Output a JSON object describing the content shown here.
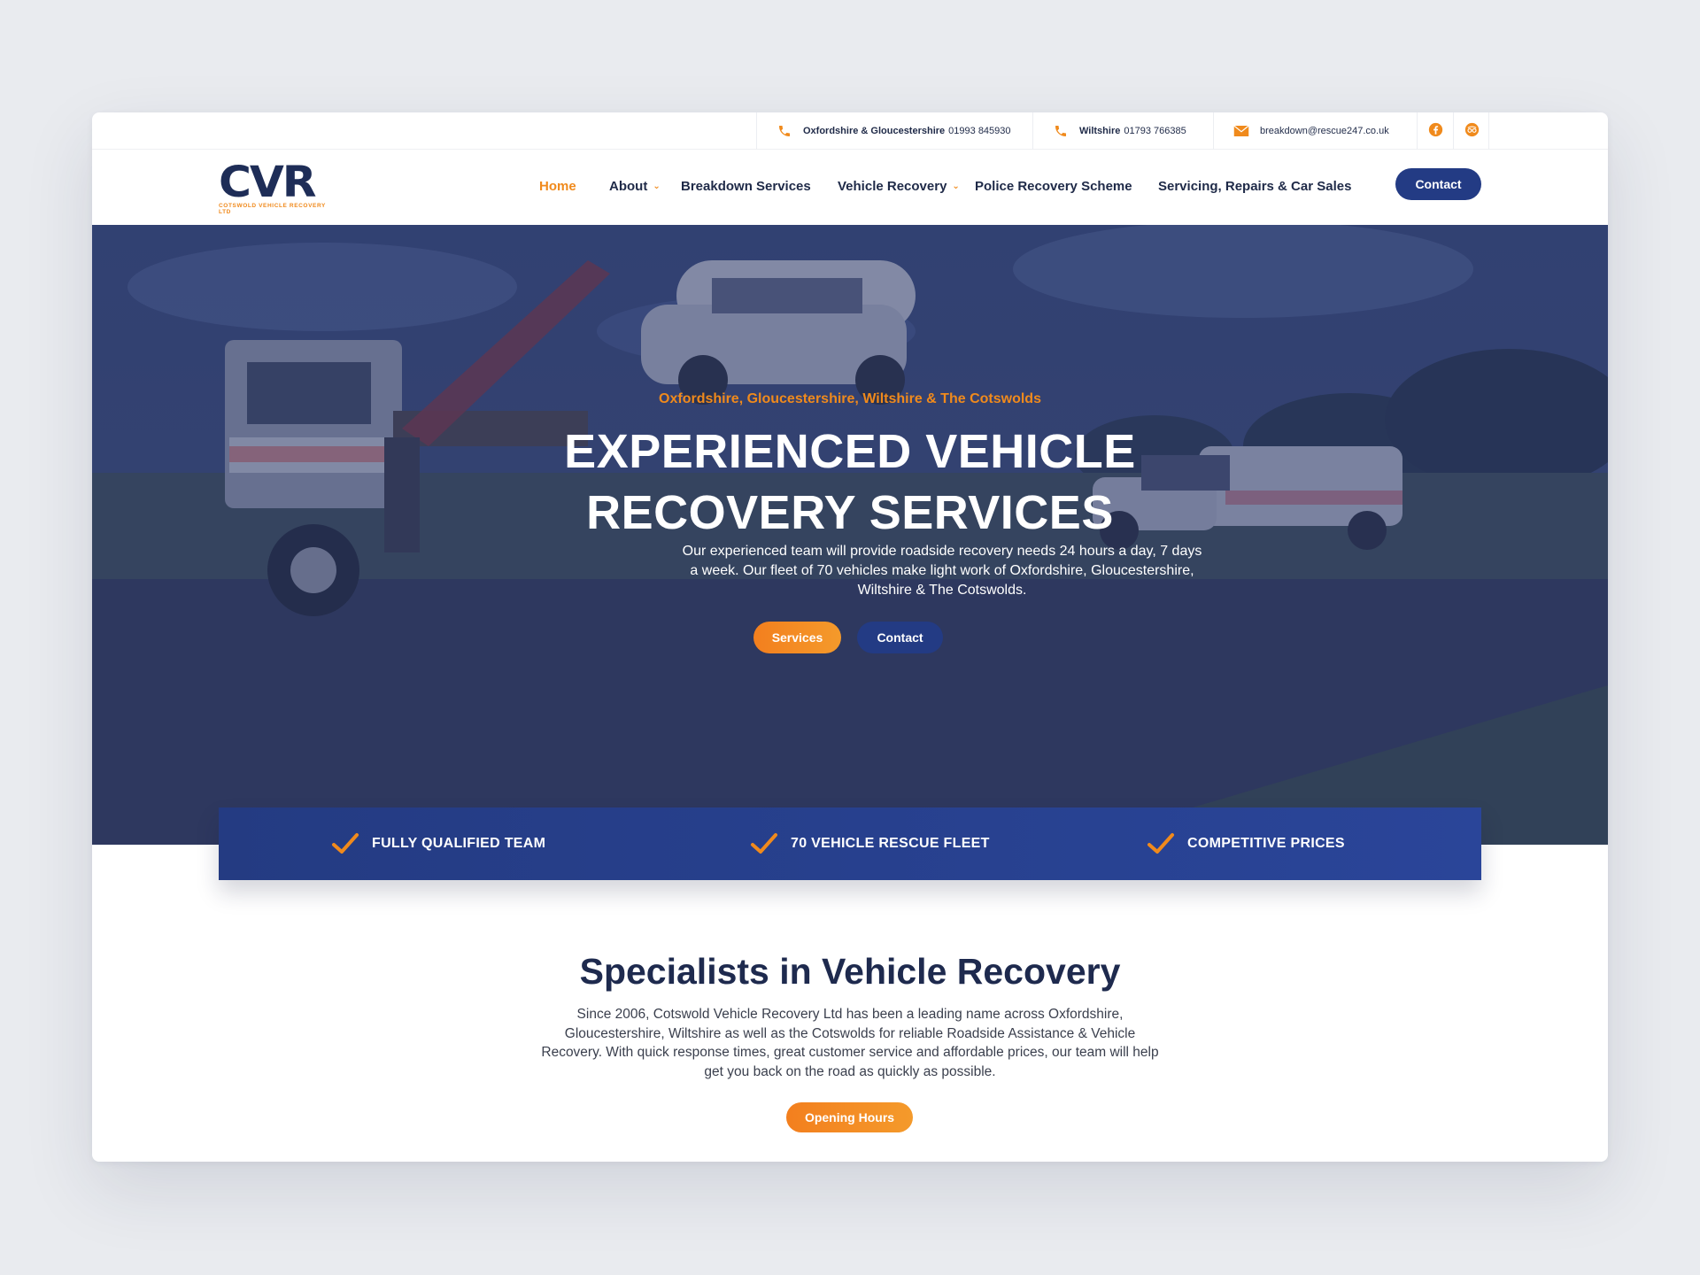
{
  "topbar": {
    "contacts": [
      {
        "region": "Oxfordshire & Gloucestershire",
        "number": "01993 845930",
        "icon": "phone-icon"
      },
      {
        "region": "Wiltshire",
        "number": "01793 766385",
        "icon": "phone-icon"
      },
      {
        "email": "breakdown@rescue247.co.uk",
        "icon": "mail-icon"
      }
    ],
    "social": [
      "facebook-icon",
      "tripadvisor-icon"
    ]
  },
  "logo": {
    "text": "CVR",
    "subtitle": "COTSWOLD VEHICLE RECOVERY LTD"
  },
  "nav": {
    "items": [
      {
        "label": "Home",
        "active": true
      },
      {
        "label": "About",
        "dropdown": true
      },
      {
        "label": "Breakdown Services"
      },
      {
        "label": "Vehicle Recovery",
        "dropdown": true
      },
      {
        "label": "Police Recovery Scheme"
      },
      {
        "label": "Servicing, Repairs & Car Sales"
      }
    ],
    "contact_label": "Contact"
  },
  "hero": {
    "kicker": "Oxfordshire,  Gloucestershire, Wiltshire & The Cotswolds",
    "title_line1": "EXPERIENCED VEHICLE",
    "title_line2": "RECOVERY SERVICES",
    "text": "Our experienced team will provide roadside recovery needs 24 hours a day, 7 days a week. Our fleet of 70 vehicles make light work of Oxfordshire, Gloucestershire, Wiltshire & The Cotswolds.",
    "btn_services": "Services",
    "btn_contact": "Contact"
  },
  "features": [
    {
      "label": "FULLY QUALIFIED TEAM"
    },
    {
      "label": "70 VEHICLE RESCUE FLEET"
    },
    {
      "label": "COMPETITIVE PRICES"
    }
  ],
  "about": {
    "title": "Specialists in Vehicle Recovery",
    "text": "Since 2006, Cotswold Vehicle Recovery Ltd has been a leading name across Oxfordshire, Gloucestershire, Wiltshire as well as the Cotswolds for reliable Roadside Assistance & Vehicle Recovery. With quick response times, great customer service and affordable prices, our team will help get you back on the road as quickly as possible.",
    "btn_hours": "Opening Hours"
  },
  "colors": {
    "brand_navy": "#233b84",
    "accent_orange": "#f08a1c",
    "text_dark": "#1e2a4e"
  }
}
